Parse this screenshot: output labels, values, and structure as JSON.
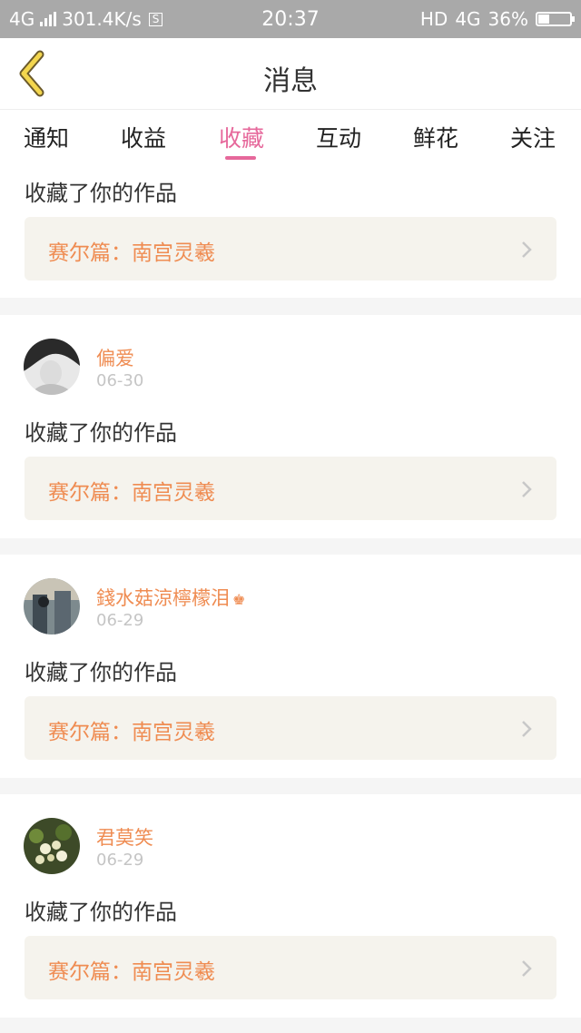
{
  "status_bar": {
    "network": "4G",
    "speed": "301.4K/s",
    "s_badge": "S",
    "time": "20:37",
    "hd": "HD",
    "network_right": "4G",
    "battery": "36%",
    "battery_level": 0.36
  },
  "header": {
    "title": "消息"
  },
  "tabs": [
    {
      "label": "通知",
      "active": false
    },
    {
      "label": "收益",
      "active": false
    },
    {
      "label": "收藏",
      "active": true
    },
    {
      "label": "互动",
      "active": false
    },
    {
      "label": "鲜花",
      "active": false
    },
    {
      "label": "关注",
      "active": false
    }
  ],
  "messages": [
    {
      "message": "收藏了你的作品",
      "work_title": "赛尔篇：南宫灵羲"
    },
    {
      "user": "偏爱",
      "date": "06-30",
      "message": "收藏了你的作品",
      "work_title": "赛尔篇：南宫灵羲"
    },
    {
      "user": "錢水菇涼檸檬泪",
      "crown": "♚",
      "date": "06-29",
      "message": "收藏了你的作品",
      "work_title": "赛尔篇：南宫灵羲"
    },
    {
      "user": "君莫笑",
      "date": "06-29",
      "message": "收藏了你的作品",
      "work_title": "赛尔篇：南宫灵羲"
    }
  ],
  "icons": {
    "back": "chevron-left-icon",
    "item_arrow": "chevron-right-icon"
  },
  "colors": {
    "accent": "#e6689b",
    "username": "#ef8c52",
    "work_bg": "#f5f3ed",
    "status_bar": "#a9a9a9"
  }
}
